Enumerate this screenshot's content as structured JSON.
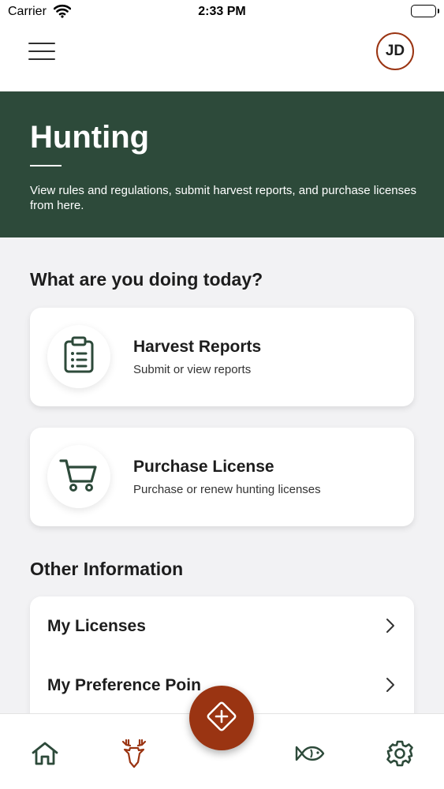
{
  "status_bar": {
    "carrier": "Carrier",
    "time": "2:33 PM"
  },
  "header": {
    "avatar_initials": "JD"
  },
  "hero": {
    "title": "Hunting",
    "description": "View rules and regulations, submit harvest reports, and purchase licenses from here."
  },
  "actions_section": {
    "title": "What are you doing today?",
    "cards": [
      {
        "title": "Harvest Reports",
        "subtitle": "Submit or view reports",
        "icon": "clipboard-list-icon"
      },
      {
        "title": "Purchase License",
        "subtitle": "Purchase or renew hunting licenses",
        "icon": "shopping-cart-icon"
      }
    ]
  },
  "other_section": {
    "title": "Other Information",
    "items": [
      {
        "label": "My Licenses"
      },
      {
        "label": "My Preference Poin"
      }
    ]
  },
  "tab_bar": {
    "tabs": [
      {
        "icon": "home-icon"
      },
      {
        "icon": "deer-icon",
        "active": true
      },
      {
        "icon": "fish-icon"
      },
      {
        "icon": "gear-icon"
      }
    ],
    "fab_icon": "diamond-plus-icon"
  },
  "colors": {
    "hero_bg": "#2d4a3a",
    "accent": "#9a3412",
    "icon_dark_green": "#2d4a3a",
    "page_bg": "#f2f2f4"
  }
}
